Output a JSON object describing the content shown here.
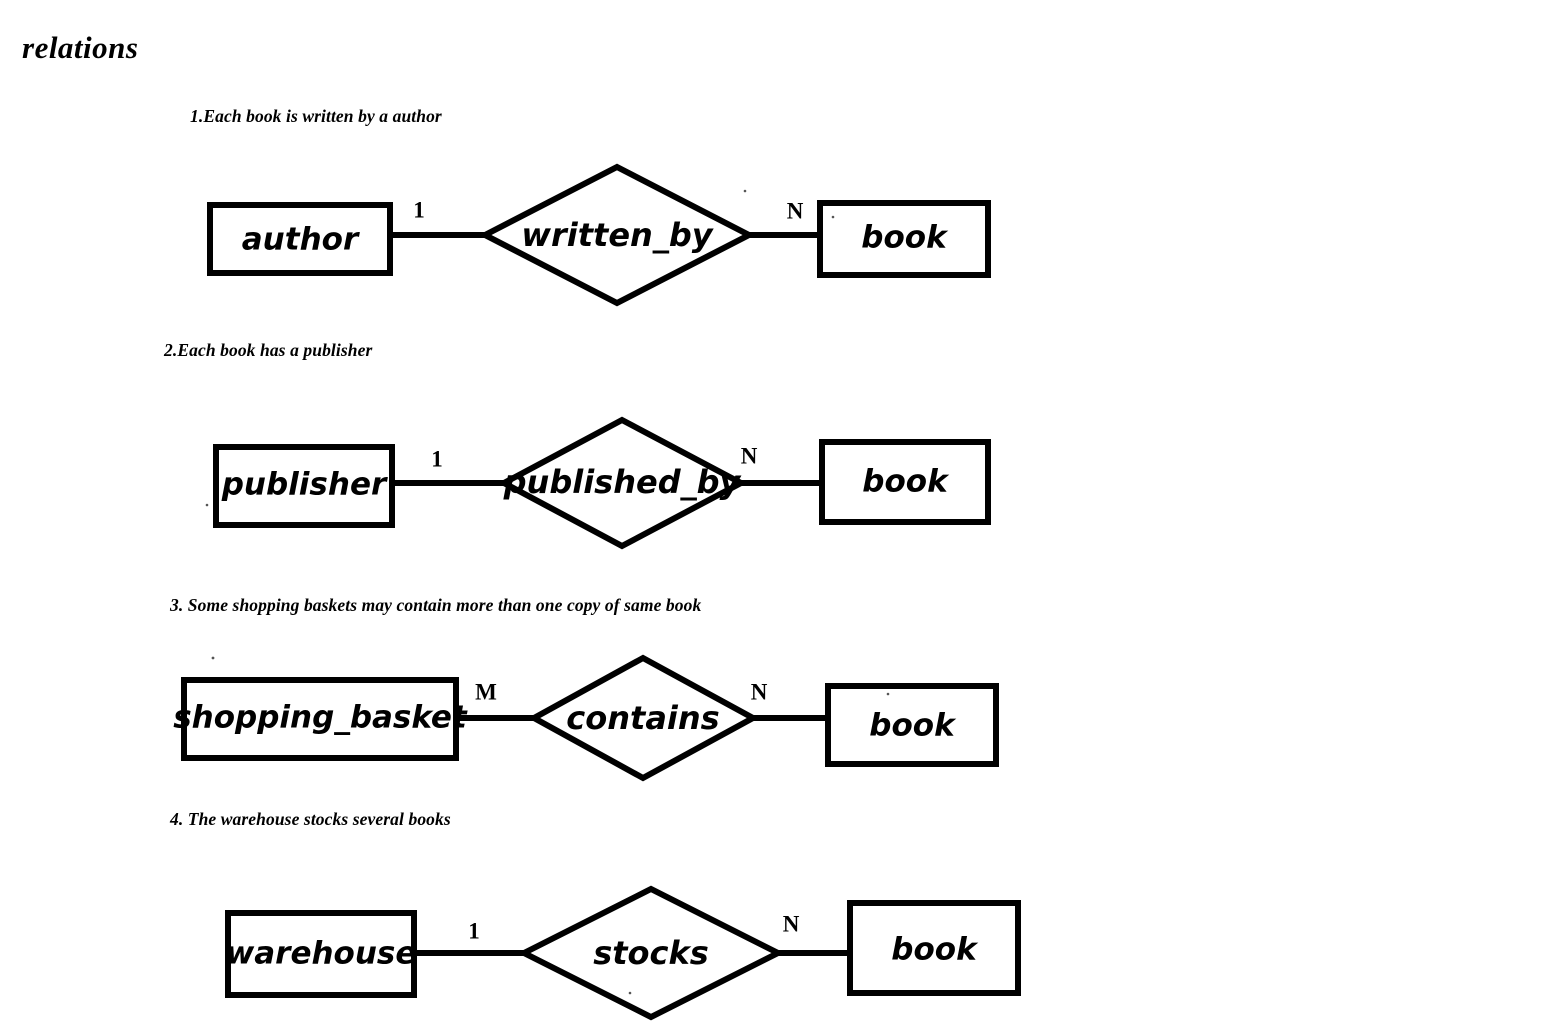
{
  "page": {
    "title": "relations"
  },
  "sections": [
    {
      "caption": "1.Each book is written by a author",
      "left_entity": "author",
      "left_cardinality": "1",
      "relationship": "written_by",
      "right_cardinality": "N",
      "right_entity": "book"
    },
    {
      "caption": "2.Each book has a publisher",
      "left_entity": "publisher",
      "left_cardinality": "1",
      "relationship": "published_by",
      "right_cardinality": "N",
      "right_entity": "book"
    },
    {
      "caption": "3. Some shopping baskets may contain more than one copy of same book",
      "left_entity": "shopping_basket",
      "left_cardinality": "M",
      "relationship": "contains",
      "right_cardinality": "N",
      "right_entity": "book"
    },
    {
      "caption": "4. The warehouse stocks several books",
      "left_entity": "warehouse",
      "left_cardinality": "1",
      "relationship": "stocks",
      "right_cardinality": "N",
      "right_entity": "book"
    }
  ],
  "colors": {
    "ink": "#000000",
    "paper": "#ffffff"
  }
}
